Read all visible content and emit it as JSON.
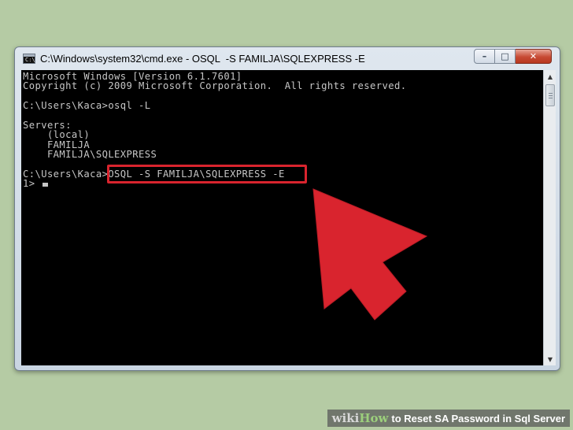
{
  "window": {
    "title": "C:\\Windows\\system32\\cmd.exe - OSQL  -S FAMILJA\\SQLEXPRESS -E",
    "icon": "cmd-icon",
    "icon_glyph": "C:\\",
    "buttons": {
      "minimize": "–",
      "maximize": "□",
      "close": "✕"
    }
  },
  "console": {
    "lines": [
      "Microsoft Windows [Version 6.1.7601]",
      "Copyright (c) 2009 Microsoft Corporation.  All rights reserved.",
      "",
      "C:\\Users\\Kaca>osql -L",
      "",
      "Servers:",
      "    (local)",
      "    FAMILJA",
      "    FAMILJA\\SQLEXPRESS",
      "",
      "C:\\Users\\Kaca>OSQL -S FAMILJA\\SQLEXPRESS -E",
      "1> "
    ],
    "text_color": "#c6c6c6",
    "background": "#000000"
  },
  "annotation": {
    "highlight_color": "#d9242e",
    "arrow_color": "#d9242e"
  },
  "scrollbar": {
    "up": "▲",
    "down": "▼"
  },
  "caption": {
    "logo_wiki": "wiki",
    "logo_how": "How",
    "title": "to Reset SA Password in Sql Server"
  }
}
